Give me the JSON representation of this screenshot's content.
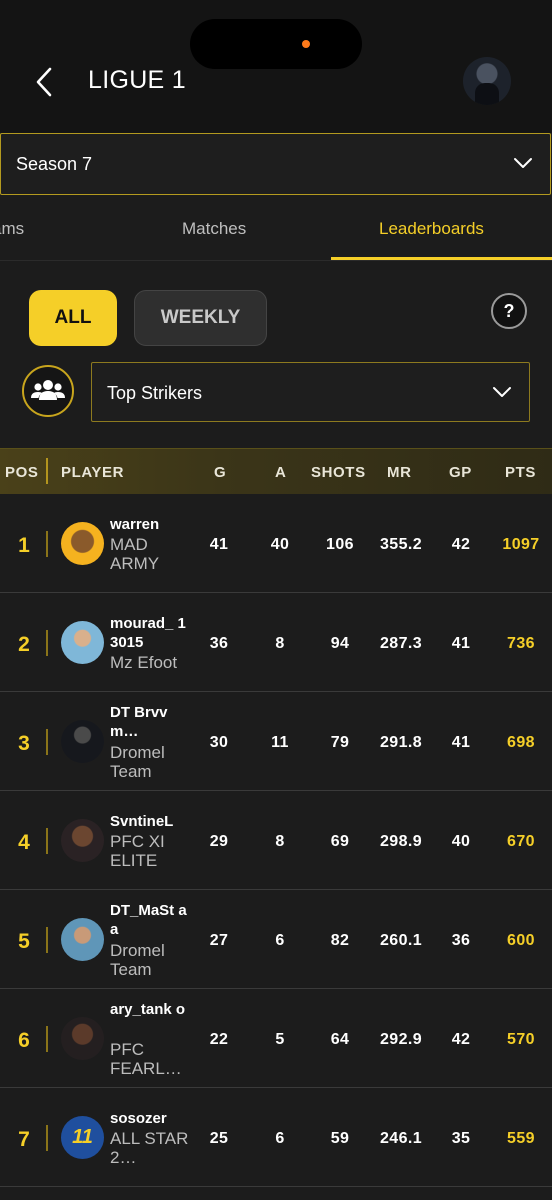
{
  "header": {
    "title": "LIGUE 1",
    "back_icon": "chevron-left-icon"
  },
  "season": {
    "selected": "Season 7"
  },
  "tabs": [
    "ams",
    "Matches",
    "Leaderboards"
  ],
  "active_tab": "Leaderboards",
  "filters": {
    "all": "ALL",
    "weekly": "WEEKLY",
    "active": "ALL",
    "help": "?"
  },
  "category": {
    "selected": "Top Strikers"
  },
  "colors": {
    "accent": "#f5cf28",
    "background": "#1c1c1c",
    "header": "#141414"
  },
  "table": {
    "columns": [
      "POS",
      "PLAYER",
      "G",
      "A",
      "SHOTS",
      "MR",
      "GP",
      "PTS"
    ],
    "rows": [
      {
        "pos": "1",
        "name": "warren",
        "team": "MAD ARMY",
        "g": "41",
        "a": "40",
        "shots": "106",
        "mr": "355.2",
        "gp": "42",
        "pts": "1097"
      },
      {
        "pos": "2",
        "name": "mourad_ 13015",
        "team": "Mz Efoot",
        "g": "36",
        "a": "8",
        "shots": "94",
        "mr": "287.3",
        "gp": "41",
        "pts": "736"
      },
      {
        "pos": "3",
        "name": "DT Brvvm…",
        "team": "Dromel Team",
        "g": "30",
        "a": "11",
        "shots": "79",
        "mr": "291.8",
        "gp": "41",
        "pts": "698"
      },
      {
        "pos": "4",
        "name": "SvntineL",
        "team": "PFC XI ELITE",
        "g": "29",
        "a": "8",
        "shots": "69",
        "mr": "298.9",
        "gp": "40",
        "pts": "670"
      },
      {
        "pos": "5",
        "name": "DT_MaSt aa",
        "team": "Dromel Team",
        "g": "27",
        "a": "6",
        "shots": "82",
        "mr": "260.1",
        "gp": "36",
        "pts": "600"
      },
      {
        "pos": "6",
        "name": "ary_tank o",
        "team": "PFC FEARL…",
        "g": "22",
        "a": "5",
        "shots": "64",
        "mr": "292.9",
        "gp": "42",
        "pts": "570"
      },
      {
        "pos": "7",
        "name": "sosozer",
        "team": "ALL STAR 2…",
        "g": "25",
        "a": "6",
        "shots": "59",
        "mr": "246.1",
        "gp": "35",
        "pts": "559",
        "avatar_text": "11"
      }
    ]
  }
}
